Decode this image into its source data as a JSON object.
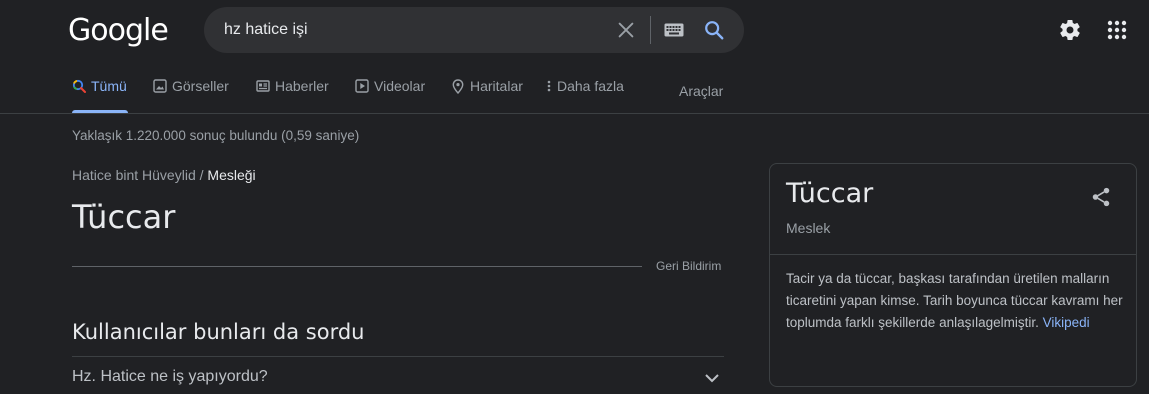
{
  "header": {
    "logo": "Google",
    "search": {
      "value": "hz hatice işi"
    }
  },
  "tabs": [
    {
      "label": "Tümü",
      "icon": "search-icon",
      "active": true
    },
    {
      "label": "Görseller",
      "icon": "image-icon"
    },
    {
      "label": "Haberler",
      "icon": "news-icon"
    },
    {
      "label": "Videolar",
      "icon": "play-icon"
    },
    {
      "label": "Haritalar",
      "icon": "map-pin-icon"
    },
    {
      "label": "Daha fazla",
      "icon": "more-vert-icon"
    }
  ],
  "tools_label": "Araçlar",
  "result_stats": "Yaklaşık 1.220.000 sonuç bulundu (0,59 saniye)",
  "answer": {
    "breadcrumb_parent": "Hatice bint Hüveylid",
    "breadcrumb_sep": "/",
    "breadcrumb_current": "Mesleği",
    "title": "Tüccar",
    "feedback_label": "Geri Bildirim"
  },
  "paa": {
    "title": "Kullanıcılar bunları da sordu",
    "questions": [
      "Hz. Hatice ne iş yapıyordu?"
    ]
  },
  "knowledge_panel": {
    "title": "Tüccar",
    "subtitle": "Meslek",
    "description": "Tacir ya da tüccar, başkası tarafından üretilen malların ticaretini yapan kimse. Tarih boyunca tüccar kavramı her toplumda farklı şekillerde anlaşılagelmiştir.",
    "source_link": "Vikipedi"
  },
  "colors": {
    "background": "#202124",
    "accent": "#8ab4f8",
    "text": "#bdc1c6",
    "title": "#e8eaed"
  }
}
